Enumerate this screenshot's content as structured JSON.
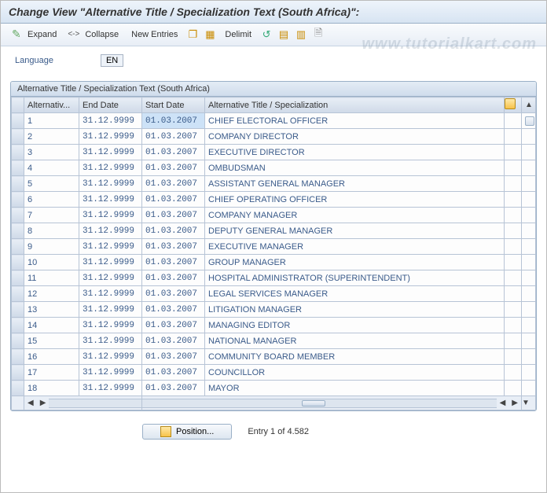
{
  "title": "Change View \"Alternative Title / Specialization Text (South Africa)\":",
  "watermark": "www.tutorialkart.com",
  "toolbar": {
    "expand": "Expand",
    "collapse": "Collapse",
    "new_entries": "New Entries",
    "delimit": "Delimit"
  },
  "language": {
    "label": "Language",
    "value": "EN"
  },
  "panel_title": "Alternative Title / Specialization Text (South Africa)",
  "columns": {
    "alt": "Alternativ...",
    "end": "End Date",
    "start": "Start Date",
    "title": "Alternative Title / Specialization"
  },
  "rows": [
    {
      "n": "1",
      "end": "31.12.9999",
      "start": "01.03.2007",
      "t": "CHIEF ELECTORAL OFFICER"
    },
    {
      "n": "2",
      "end": "31.12.9999",
      "start": "01.03.2007",
      "t": "COMPANY DIRECTOR"
    },
    {
      "n": "3",
      "end": "31.12.9999",
      "start": "01.03.2007",
      "t": "EXECUTIVE DIRECTOR"
    },
    {
      "n": "4",
      "end": "31.12.9999",
      "start": "01.03.2007",
      "t": "OMBUDSMAN"
    },
    {
      "n": "5",
      "end": "31.12.9999",
      "start": "01.03.2007",
      "t": "ASSISTANT GENERAL MANAGER"
    },
    {
      "n": "6",
      "end": "31.12.9999",
      "start": "01.03.2007",
      "t": "CHIEF OPERATING OFFICER"
    },
    {
      "n": "7",
      "end": "31.12.9999",
      "start": "01.03.2007",
      "t": "COMPANY MANAGER"
    },
    {
      "n": "8",
      "end": "31.12.9999",
      "start": "01.03.2007",
      "t": "DEPUTY GENERAL MANAGER"
    },
    {
      "n": "9",
      "end": "31.12.9999",
      "start": "01.03.2007",
      "t": "EXECUTIVE MANAGER"
    },
    {
      "n": "10",
      "end": "31.12.9999",
      "start": "01.03.2007",
      "t": "GROUP MANAGER"
    },
    {
      "n": "11",
      "end": "31.12.9999",
      "start": "01.03.2007",
      "t": "HOSPITAL ADMINISTRATOR (SUPERINTENDENT)"
    },
    {
      "n": "12",
      "end": "31.12.9999",
      "start": "01.03.2007",
      "t": "LEGAL SERVICES MANAGER"
    },
    {
      "n": "13",
      "end": "31.12.9999",
      "start": "01.03.2007",
      "t": "LITIGATION MANAGER"
    },
    {
      "n": "14",
      "end": "31.12.9999",
      "start": "01.03.2007",
      "t": "MANAGING EDITOR"
    },
    {
      "n": "15",
      "end": "31.12.9999",
      "start": "01.03.2007",
      "t": "NATIONAL MANAGER"
    },
    {
      "n": "16",
      "end": "31.12.9999",
      "start": "01.03.2007",
      "t": "COMMUNITY BOARD MEMBER"
    },
    {
      "n": "17",
      "end": "31.12.9999",
      "start": "01.03.2007",
      "t": "COUNCILLOR"
    },
    {
      "n": "18",
      "end": "31.12.9999",
      "start": "01.03.2007",
      "t": "MAYOR"
    }
  ],
  "footer": {
    "position": "Position...",
    "entry": "Entry 1 of 4.582"
  }
}
